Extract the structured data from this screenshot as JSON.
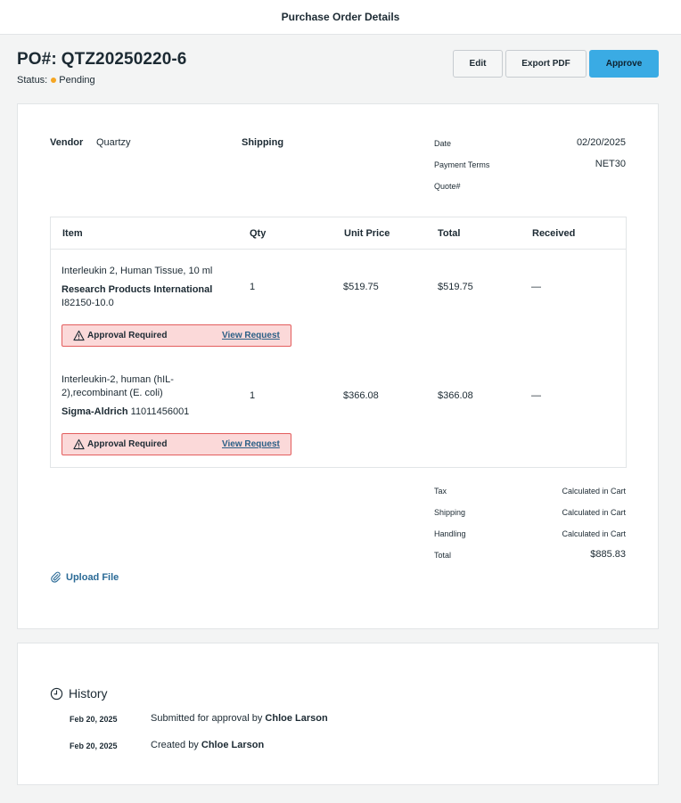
{
  "header": {
    "title": "Purchase Order Details"
  },
  "po": {
    "label": "PO#:",
    "number": "QTZ20250220-6",
    "status_label": "Status:",
    "status": "Pending",
    "status_color": "#f5a623"
  },
  "actions": {
    "edit": "Edit",
    "export": "Export PDF",
    "approve": "Approve",
    "accent": "#3aabe4"
  },
  "details": {
    "vendor_label": "Vendor",
    "vendor": "Quartzy",
    "shipping_label": "Shipping",
    "date_label": "Date",
    "date": "02/20/2025",
    "terms_label": "Payment Terms",
    "terms": "NET30",
    "quote_label": "Quote#",
    "quote": ""
  },
  "table": {
    "columns": [
      "Item",
      "Qty",
      "Unit Price",
      "Total",
      "Received"
    ],
    "rows": [
      {
        "name": "Interleukin 2, Human Tissue, 10 ml",
        "vendor": "Research Products International",
        "sku": "I82150-10.0",
        "qty": "1",
        "unit_price": "$519.75",
        "total": "$519.75",
        "received": "—",
        "approval_text": "Approval Required",
        "approval_link": "View Request"
      },
      {
        "name": "Interleukin-2, human (hIL-2),recombinant (E. coli)",
        "vendor": "Sigma-Aldrich",
        "sku": "11011456001",
        "qty": "1",
        "unit_price": "$366.08",
        "total": "$366.08",
        "received": "—",
        "approval_text": "Approval Required",
        "approval_link": "View Request"
      }
    ]
  },
  "summary": {
    "tax_label": "Tax",
    "tax": "Calculated in Cart",
    "shipping_label": "Shipping",
    "shipping": "Calculated in Cart",
    "handling_label": "Handling",
    "handling": "Calculated in Cart",
    "total_label": "Total",
    "total": "$885.83"
  },
  "upload": {
    "label": "Upload File"
  },
  "history": {
    "title": "History",
    "entries": [
      {
        "date": "Feb 20, 2025",
        "text": "Submitted for approval by",
        "user": "Chloe Larson"
      },
      {
        "date": "Feb 20, 2025",
        "text": "Created by",
        "user": "Chloe Larson"
      }
    ]
  }
}
